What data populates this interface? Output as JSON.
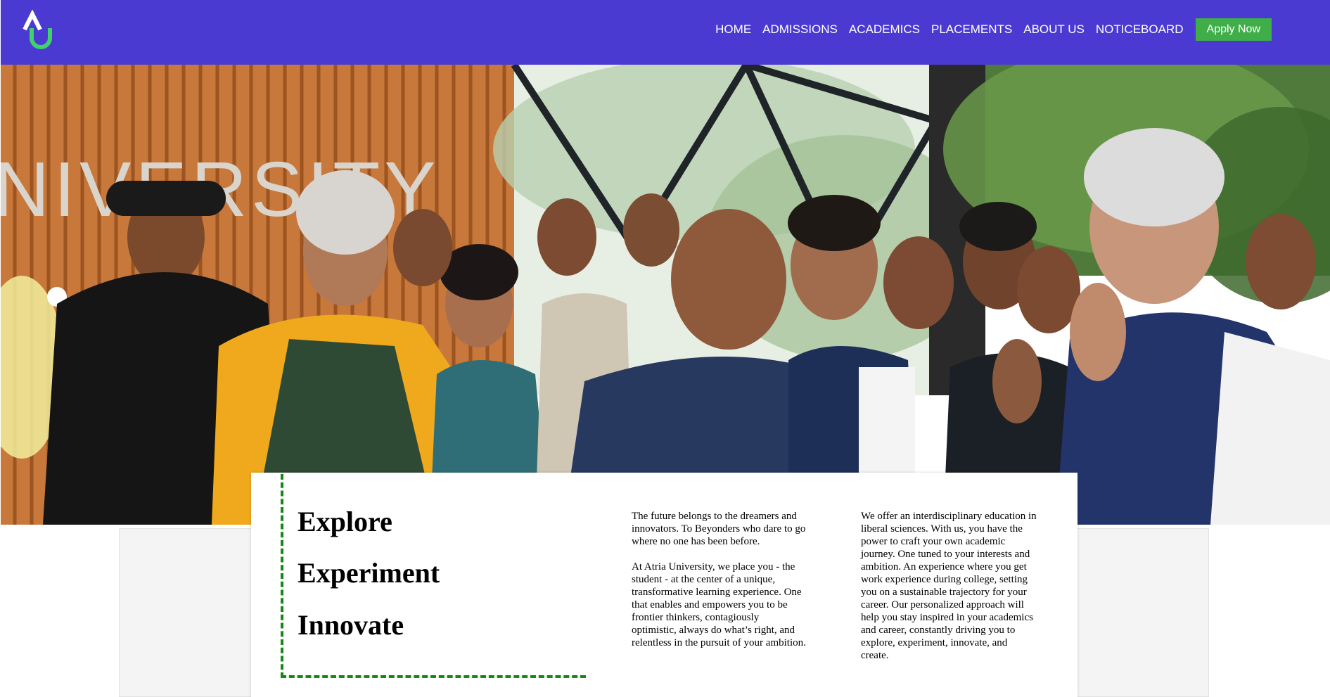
{
  "header": {
    "logo_alt": "AU",
    "nav": [
      "HOME",
      "ADMISSIONS",
      "ACADEMICS",
      "PLACEMENTS",
      "ABOUT US",
      "NOTICEBOARD"
    ],
    "apply_label": "Apply Now"
  },
  "hero": {
    "wall_text": "NIVERSITY"
  },
  "intro": {
    "motto": [
      "Explore",
      "Experiment",
      "Innovate"
    ],
    "col1": [
      "The future belongs to the dreamers and innovators. To Beyonders who dare to go where no one has been before.",
      "At Atria University, we place you - the student - at the center of a unique, transformative learning experience. One that enables and empowers you to be frontier thinkers, contagiously optimistic, always do what’s right, and relentless in the pursuit of your ambition."
    ],
    "col2": [
      "We offer an interdisciplinary education in liberal sciences. With us, you have the power to craft your own academic journey. One tuned to your interests and ambition. An experience where you get work experience during college, setting you on a sustainable trajectory for your career. Our personalized approach will help you stay inspired in your academics and career, constantly driving you to explore, experiment, innovate, and create."
    ]
  },
  "colors": {
    "header_bg": "#4b3ad2",
    "logo_green": "#3fd16a",
    "apply_bg": "#3fae49",
    "dashed_border": "#138a13"
  }
}
